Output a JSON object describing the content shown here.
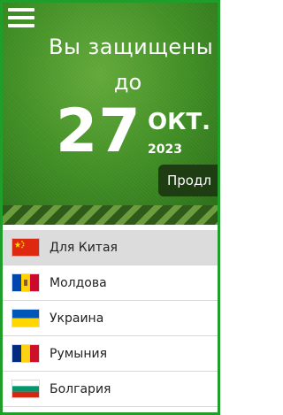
{
  "header": {
    "protected_line1": "Вы защищены",
    "protected_line2": "до",
    "day": "27",
    "month": "ОКТ.",
    "year": "2023",
    "renew_label": "Продл"
  },
  "servers": [
    {
      "label": "Для Китая",
      "flag": "china-flag-icon",
      "selected": true
    },
    {
      "label": "Молдова",
      "flag": "moldova-flag-icon",
      "selected": false
    },
    {
      "label": "Украина",
      "flag": "ukraine-flag-icon",
      "selected": false
    },
    {
      "label": "Румыния",
      "flag": "romania-flag-icon",
      "selected": false
    },
    {
      "label": "Болгария",
      "flag": "bulgaria-flag-icon",
      "selected": false
    }
  ],
  "colors": {
    "frame": "#1f9e2a",
    "hero_green": "#3f8d24",
    "renew_button": "#1f3d12",
    "selected_row": "#dcdcdc"
  }
}
